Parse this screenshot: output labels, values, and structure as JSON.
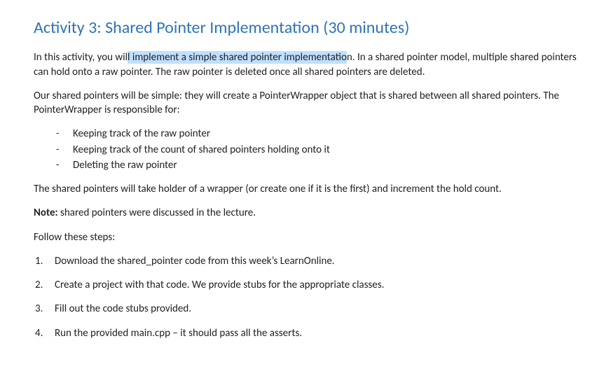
{
  "heading": "Activity 3: Shared Pointer Implementation (30 minutes)",
  "intro": {
    "pre": "In this activity, you wil",
    "highlight": "l implement a simple shared pointer implementatio",
    "post": "n. In a shared pointer model, multiple shared pointers can hold onto a raw pointer. The raw pointer is deleted once all shared pointers are deleted."
  },
  "para2": "Our shared pointers will be simple: they will create a PointerWrapper object that is shared between all shared pointers. The PointerWrapper is responsible for:",
  "bullets": [
    "Keeping track of the raw pointer",
    "Keeping track of the count of shared pointers holding onto it",
    "Deleting the raw pointer"
  ],
  "para3": "The shared pointers will take holder of a wrapper (or create one if it is the first) and increment the hold count.",
  "note_label": "Note:",
  "note_text": " shared pointers were discussed in the lecture.",
  "follow": "Follow these steps:",
  "steps": [
    "Download the shared_pointer code from this week’s LearnOnline.",
    "Create a project with that code. We provide stubs for the appropriate classes.",
    "Fill out the code stubs provided.",
    "Run the provided main.cpp – it should pass all the asserts."
  ]
}
